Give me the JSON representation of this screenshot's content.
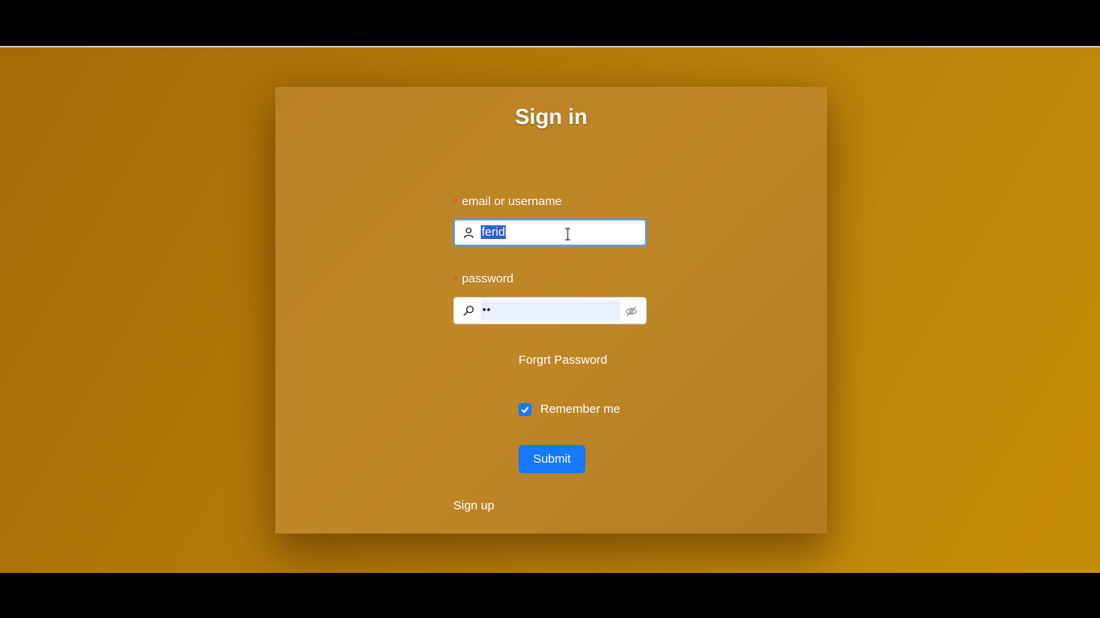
{
  "form": {
    "title": "Sign in",
    "username_label": "email or username",
    "username_value": "ferid",
    "password_label": "password",
    "password_value": "••",
    "forgot_link": "Forgrt Password",
    "remember_label": "Remember me",
    "remember_checked": true,
    "submit_label": "Submit",
    "signup_link": "Sign up",
    "required_mark": "*"
  },
  "icons": {
    "username_icon": "user-icon",
    "password_icon": "key-icon",
    "toggle_icon": "eye-invisible-icon"
  },
  "colors": {
    "primary": "#1677ff",
    "required": "#ff4d4f",
    "background": "#b37a0a",
    "card": "#bb8225"
  }
}
